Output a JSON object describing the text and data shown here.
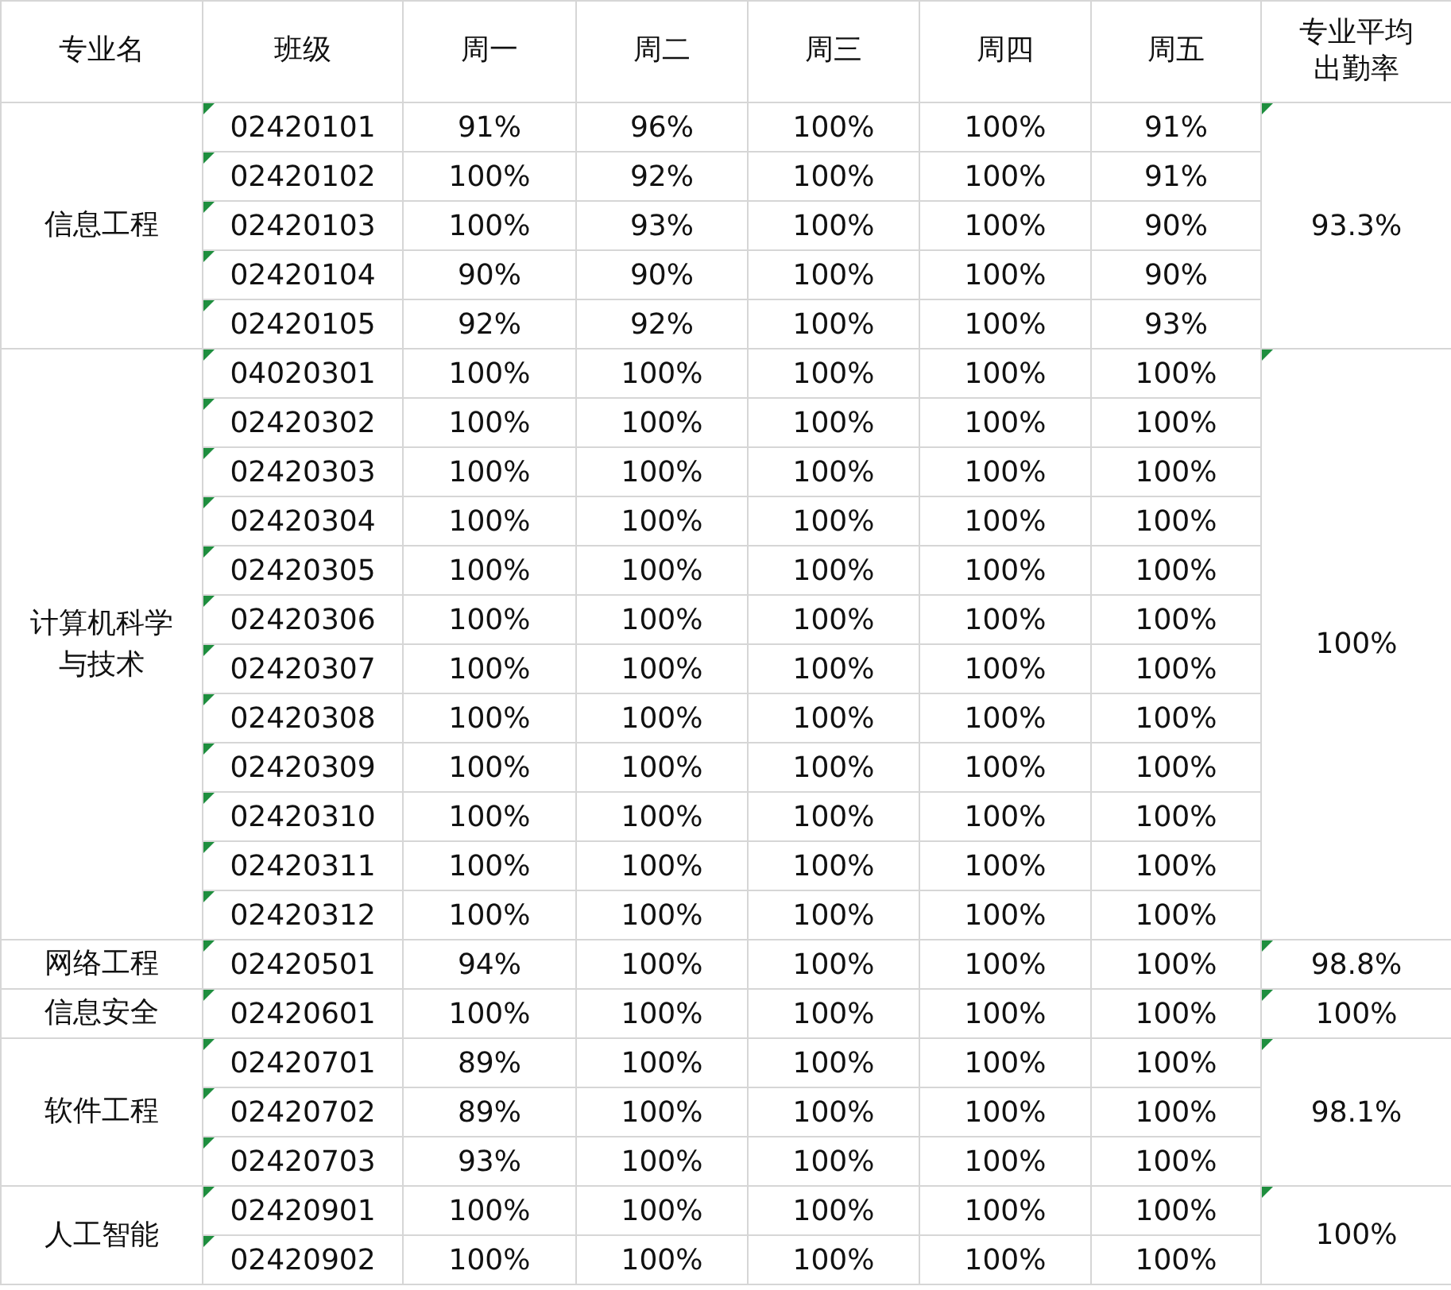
{
  "table": {
    "columns": [
      "专业名",
      "班级",
      "周一",
      "周二",
      "周三",
      "周四",
      "周五",
      "专业平均出勤率"
    ],
    "groups": [
      {
        "major": "信息工程",
        "average": "93.3%",
        "average_flag": true,
        "rows": [
          {
            "class": "02420101",
            "flag": true,
            "days": [
              "91%",
              "96%",
              "100%",
              "100%",
              "91%"
            ]
          },
          {
            "class": "02420102",
            "flag": true,
            "days": [
              "100%",
              "92%",
              "100%",
              "100%",
              "91%"
            ]
          },
          {
            "class": "02420103",
            "flag": true,
            "days": [
              "100%",
              "93%",
              "100%",
              "100%",
              "90%"
            ]
          },
          {
            "class": "02420104",
            "flag": true,
            "days": [
              "90%",
              "90%",
              "100%",
              "100%",
              "90%"
            ]
          },
          {
            "class": "02420105",
            "flag": true,
            "days": [
              "92%",
              "92%",
              "100%",
              "100%",
              "93%"
            ]
          }
        ]
      },
      {
        "major": "计算机科学与技术",
        "average": "100%",
        "average_flag": true,
        "rows": [
          {
            "class": "04020301",
            "flag": true,
            "days": [
              "100%",
              "100%",
              "100%",
              "100%",
              "100%"
            ]
          },
          {
            "class": "02420302",
            "flag": true,
            "days": [
              "100%",
              "100%",
              "100%",
              "100%",
              "100%"
            ]
          },
          {
            "class": "02420303",
            "flag": true,
            "days": [
              "100%",
              "100%",
              "100%",
              "100%",
              "100%"
            ]
          },
          {
            "class": "02420304",
            "flag": true,
            "days": [
              "100%",
              "100%",
              "100%",
              "100%",
              "100%"
            ]
          },
          {
            "class": "02420305",
            "flag": true,
            "days": [
              "100%",
              "100%",
              "100%",
              "100%",
              "100%"
            ]
          },
          {
            "class": "02420306",
            "flag": true,
            "days": [
              "100%",
              "100%",
              "100%",
              "100%",
              "100%"
            ]
          },
          {
            "class": "02420307",
            "flag": true,
            "days": [
              "100%",
              "100%",
              "100%",
              "100%",
              "100%"
            ]
          },
          {
            "class": "02420308",
            "flag": true,
            "days": [
              "100%",
              "100%",
              "100%",
              "100%",
              "100%"
            ]
          },
          {
            "class": "02420309",
            "flag": true,
            "days": [
              "100%",
              "100%",
              "100%",
              "100%",
              "100%"
            ]
          },
          {
            "class": "02420310",
            "flag": true,
            "days": [
              "100%",
              "100%",
              "100%",
              "100%",
              "100%"
            ]
          },
          {
            "class": "02420311",
            "flag": true,
            "days": [
              "100%",
              "100%",
              "100%",
              "100%",
              "100%"
            ]
          },
          {
            "class": "02420312",
            "flag": true,
            "days": [
              "100%",
              "100%",
              "100%",
              "100%",
              "100%"
            ]
          }
        ]
      },
      {
        "major": "网络工程",
        "average": "98.8%",
        "average_flag": true,
        "rows": [
          {
            "class": "02420501",
            "flag": true,
            "days": [
              "94%",
              "100%",
              "100%",
              "100%",
              "100%"
            ]
          }
        ]
      },
      {
        "major": "信息安全",
        "average": "100%",
        "average_flag": true,
        "rows": [
          {
            "class": "02420601",
            "flag": true,
            "days": [
              "100%",
              "100%",
              "100%",
              "100%",
              "100%"
            ]
          }
        ]
      },
      {
        "major": "软件工程",
        "average": "98.1%",
        "average_flag": true,
        "rows": [
          {
            "class": "02420701",
            "flag": true,
            "days": [
              "89%",
              "100%",
              "100%",
              "100%",
              "100%"
            ]
          },
          {
            "class": "02420702",
            "flag": true,
            "days": [
              "89%",
              "100%",
              "100%",
              "100%",
              "100%"
            ]
          },
          {
            "class": "02420703",
            "flag": true,
            "days": [
              "93%",
              "100%",
              "100%",
              "100%",
              "100%"
            ]
          }
        ]
      },
      {
        "major": "人工智能",
        "average": "100%",
        "average_flag": true,
        "rows": [
          {
            "class": "02420901",
            "flag": true,
            "days": [
              "100%",
              "100%",
              "100%",
              "100%",
              "100%"
            ]
          },
          {
            "class": "02420902",
            "flag": true,
            "days": [
              "100%",
              "100%",
              "100%",
              "100%",
              "100%"
            ]
          }
        ]
      }
    ]
  }
}
